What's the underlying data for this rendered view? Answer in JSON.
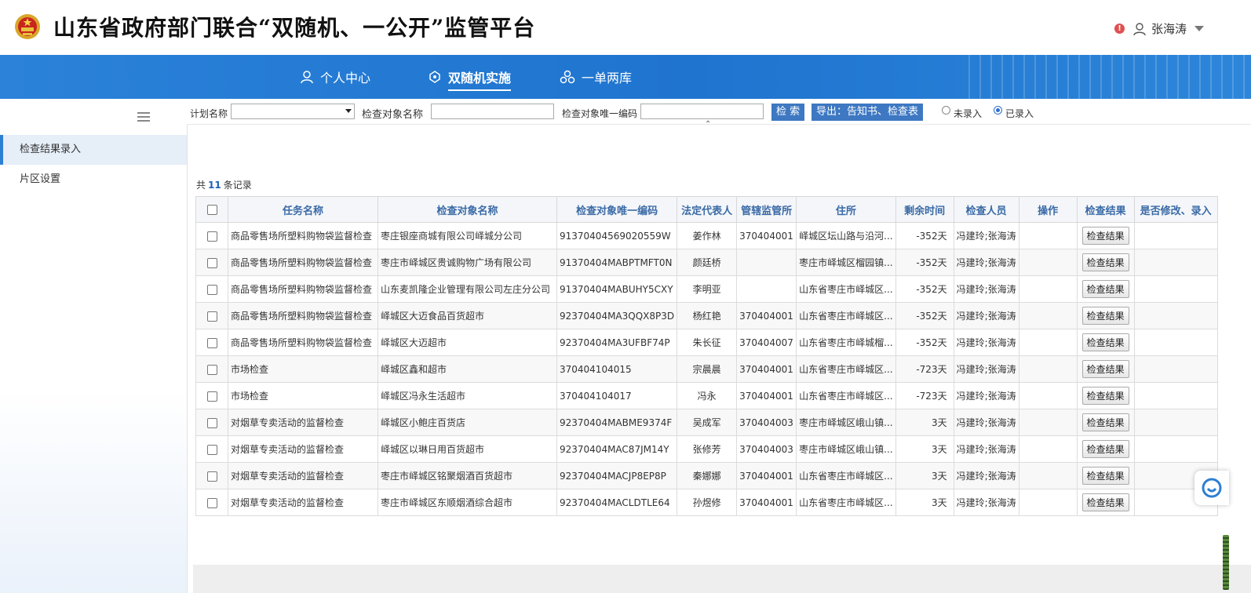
{
  "header": {
    "title": "山东省政府部门联合“双随机、一公开”监管平台",
    "alert_mark": "!",
    "user_name": "张海涛"
  },
  "nav": {
    "items": [
      {
        "label": "个人中心",
        "icon": "user-icon"
      },
      {
        "label": "双随机实施",
        "icon": "cluster-icon",
        "active": true
      },
      {
        "label": "一单两库",
        "icon": "three-circles-icon"
      }
    ]
  },
  "sidebar": {
    "items": [
      {
        "label": "检查结果录入",
        "active": true
      },
      {
        "label": "片区设置"
      }
    ]
  },
  "filter": {
    "plan_label": "计划名称",
    "plan_value": "",
    "target_name_label": "检查对象名称",
    "target_name_value": "",
    "target_code_label": "检查对象唯一编码",
    "target_code_value": "",
    "search_btn": "检 索",
    "export_btn": "导出：告知书、检查表",
    "radio_unentered": "未录入",
    "radio_entered": "已录入",
    "selected": "已录入"
  },
  "records": {
    "prefix": "共",
    "count": "11",
    "suffix": "条记录"
  },
  "table": {
    "headers": [
      "任务名称",
      "检查对象名称",
      "检查对象唯一编码",
      "法定代表人",
      "管辖监管所",
      "住所",
      "剩余时间",
      "检查人员",
      "操作",
      "检查结果",
      "是否修改、录入"
    ],
    "result_button_label": "检查结果",
    "rows": [
      {
        "task": "商品零售场所塑料购物袋监督检查",
        "target": "枣庄银座商城有限公司峄城分公司",
        "code": "91370404569020559W",
        "rep": "姜作林",
        "office": "370404001",
        "address": "峄城区坛山路与沿河...",
        "remain": "-352天",
        "inspectors": "冯建玲;张海涛",
        "op": "",
        "modified": ""
      },
      {
        "task": "商品零售场所塑料购物袋监督检查",
        "target": "枣庄市峄城区贵诚购物广场有限公司",
        "code": "91370404MABPTMFT0N",
        "rep": "颜廷桥",
        "office": "",
        "address": "枣庄市峄城区榴园镇...",
        "remain": "-352天",
        "inspectors": "冯建玲;张海涛",
        "op": "",
        "modified": ""
      },
      {
        "task": "商品零售场所塑料购物袋监督检查",
        "target": "山东麦凯隆企业管理有限公司左庄分公司",
        "code": "91370404MABUHY5CXY",
        "rep": "李明亚",
        "office": "",
        "address": "山东省枣庄市峄城区...",
        "remain": "-352天",
        "inspectors": "冯建玲;张海涛",
        "op": "",
        "modified": ""
      },
      {
        "task": "商品零售场所塑料购物袋监督检查",
        "target": "峄城区大迈食品百货超市",
        "code": "92370404MA3QQX8P3D",
        "rep": "杨红艳",
        "office": "370404001",
        "address": "山东省枣庄市峄城区...",
        "remain": "-352天",
        "inspectors": "冯建玲;张海涛",
        "op": "",
        "modified": ""
      },
      {
        "task": "商品零售场所塑料购物袋监督检查",
        "target": "峄城区大迈超市",
        "code": "92370404MA3UFBF74P",
        "rep": "朱长征",
        "office": "370404007",
        "address": "山东省枣庄市峄城榴...",
        "remain": "-352天",
        "inspectors": "冯建玲;张海涛",
        "op": "",
        "modified": ""
      },
      {
        "task": "市场检查",
        "target": "峄城区鑫和超市",
        "code": "370404104015",
        "rep": "宗晨晨",
        "office": "370404001",
        "address": "山东省枣庄市峄城区...",
        "remain": "-723天",
        "inspectors": "冯建玲;张海涛",
        "op": "",
        "modified": ""
      },
      {
        "task": "市场检查",
        "target": "峄城区冯永生活超市",
        "code": "370404104017",
        "rep": "冯永",
        "office": "370404001",
        "address": "山东省枣庄市峄城区...",
        "remain": "-723天",
        "inspectors": "冯建玲;张海涛",
        "op": "",
        "modified": ""
      },
      {
        "task": "对烟草专卖活动的监督检查",
        "target": "峄城区小鲍庄百货店",
        "code": "92370404MABME9374F",
        "rep": "吴成军",
        "office": "370404003",
        "address": "枣庄市峄城区峨山镇...",
        "remain": "3天",
        "inspectors": "冯建玲;张海涛",
        "op": "",
        "modified": ""
      },
      {
        "task": "对烟草专卖活动的监督检查",
        "target": "峄城区以琳日用百货超市",
        "code": "92370404MAC87JM14Y",
        "rep": "张修芳",
        "office": "370404003",
        "address": "枣庄市峄城区峨山镇...",
        "remain": "3天",
        "inspectors": "冯建玲;张海涛",
        "op": "",
        "modified": ""
      },
      {
        "task": "对烟草专卖活动的监督检查",
        "target": "枣庄市峄城区铭聚烟酒百货超市",
        "code": "92370404MACJP8EP8P",
        "rep": "秦娜娜",
        "office": "370404001",
        "address": "山东省枣庄市峄城区...",
        "remain": "3天",
        "inspectors": "冯建玲;张海涛",
        "op": "",
        "modified": ""
      },
      {
        "task": "对烟草专卖活动的监督检查",
        "target": "枣庄市峄城区东顺烟酒综合超市",
        "code": "92370404MACLDTLE64",
        "rep": "孙煜修",
        "office": "370404001",
        "address": "山东省枣庄市峄城区...",
        "remain": "3天",
        "inspectors": "冯建玲;张海涛",
        "op": "",
        "modified": ""
      }
    ]
  },
  "colors": {
    "nav_blue": "#2379d4",
    "header_text_blue": "#3a6aa6",
    "button_blue": "#3e78c2",
    "alert_red": "#e05050"
  }
}
